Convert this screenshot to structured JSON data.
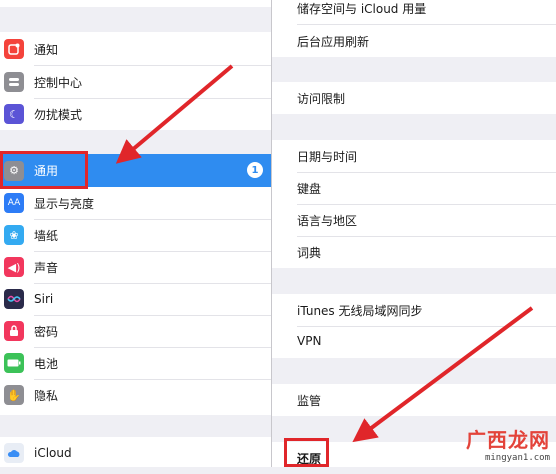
{
  "sidebar": {
    "items": [
      {
        "label": "通知",
        "icon": "notification-icon",
        "color": "#f4433b"
      },
      {
        "label": "控制中心",
        "icon": "control-center-icon",
        "color": "#8e8e93"
      },
      {
        "label": "勿扰模式",
        "icon": "moon-icon",
        "color": "#5b54d6"
      },
      {
        "label": "通用",
        "icon": "gear-icon",
        "color": "#8e8e93",
        "badge": "1",
        "selected": true
      },
      {
        "label": "显示与亮度",
        "icon": "display-brightness-icon",
        "color": "#2d7cf6"
      },
      {
        "label": "墙纸",
        "icon": "wallpaper-icon",
        "color": "#33aaf1"
      },
      {
        "label": "声音",
        "icon": "speaker-icon",
        "color": "#f2375d"
      },
      {
        "label": "Siri",
        "icon": "siri-icon",
        "color": "#2a2a4a"
      },
      {
        "label": "密码",
        "icon": "lock-icon",
        "color": "#f2375d"
      },
      {
        "label": "电池",
        "icon": "battery-icon",
        "color": "#3cc258"
      },
      {
        "label": "隐私",
        "icon": "hand-icon",
        "color": "#8e8e93"
      },
      {
        "label": "iCloud",
        "icon": "cloud-icon",
        "color": "#e8edf5"
      }
    ]
  },
  "main": {
    "groups": [
      [
        "储存空间与 iCloud 用量",
        "后台应用刷新"
      ],
      [
        "访问限制"
      ],
      [
        "日期与时间",
        "键盘",
        "语言与地区",
        "词典"
      ],
      [
        "iTunes 无线局域网同步",
        "VPN"
      ],
      [
        "监管"
      ],
      [
        "还原"
      ]
    ]
  },
  "watermark": {
    "title": "广西龙网",
    "url": "mingyan1.com"
  },
  "colors": {
    "accent": "#2f8cf0",
    "highlight": "#e0262a"
  }
}
